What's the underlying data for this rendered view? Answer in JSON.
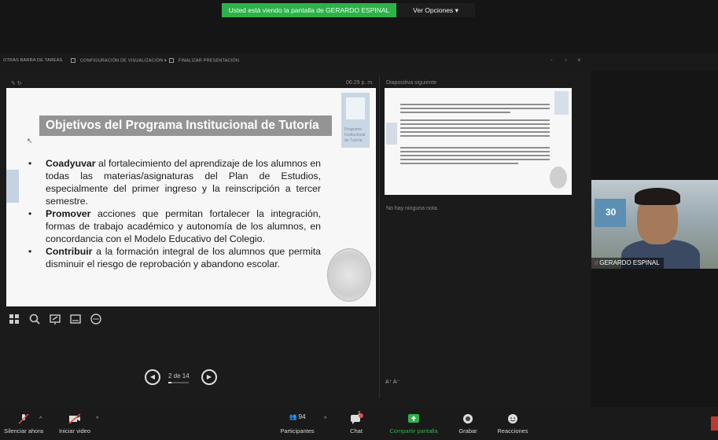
{
  "banner": {
    "text": "Usted está viendo la pantalla de GERARDO ESPINAL",
    "view_options": "Ver Opciones",
    "color": "#2db24a"
  },
  "presenter_toolbar": {
    "items": [
      "OTRAS BARRA DE TAREAS",
      "CONFIGURACIÓN DE VISUALIZACIÓN ▾",
      "FINALIZAR PRESENTACIÓN"
    ],
    "window_controls": [
      "-",
      "▫",
      "×"
    ]
  },
  "presenter": {
    "time": "06:29 p. m.",
    "next_label": "Diapositiva siguiente",
    "notes": "No hay ninguna nota.",
    "text_size_controls": "A⁺ A⁻"
  },
  "slide": {
    "title": "Objetivos del Programa Institucional de Tutoría",
    "bullets": [
      {
        "bold": "Coadyuvar",
        "text": " al fortalecimiento del aprendizaje de los alumnos en todas las materias/asignaturas del Plan de Estudios, especialmente del primer ingreso y la reinscripción a tercer semestre."
      },
      {
        "bold": "Promover",
        "text": " acciones que permitan fortalecer la integración, formas de trabajo académico y autonomía de los alumnos, en concordancia con el Modelo Educativo del Colegio."
      },
      {
        "bold": "Contribuir",
        "text": " a la formación integral de los alumnos que permita disminuir el riesgo de reprobación y abandono escolar."
      }
    ]
  },
  "navigation": {
    "counter": "2 de 14",
    "progress": 0.143
  },
  "video": {
    "name": "GERARDO ESPINAL",
    "sign": "30"
  },
  "bottom_bar": {
    "mute": "Silenciar ahora",
    "video": "Iniciar video",
    "participants": "Participantes",
    "participants_count": "94",
    "chat": "Chat",
    "chat_badge": "2",
    "share": "Compartir pantalla",
    "record": "Grabar",
    "reactions": "Reacciones",
    "share_color": "#2db24a"
  }
}
